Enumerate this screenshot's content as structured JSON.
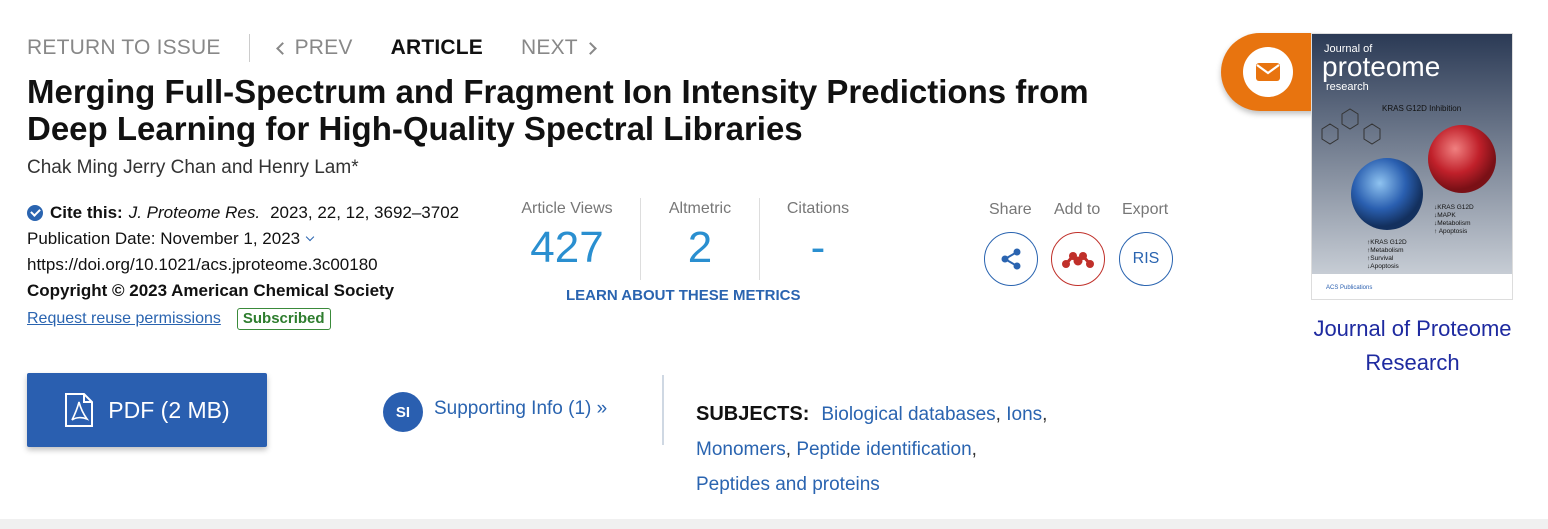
{
  "nav": {
    "return_label": "RETURN TO ISSUE",
    "prev_label": "PREV",
    "article_label": "ARTICLE",
    "next_label": "NEXT"
  },
  "article": {
    "title": "Merging Full-Spectrum and Fragment Ion Intensity Predictions from Deep Learning for High-Quality Spectral Libraries",
    "authors": "Chak Ming Jerry Chan and Henry Lam*",
    "cite_label": "Cite this:",
    "cite_journal": "J. Proteome Res.",
    "cite_ref": "2023, 22, 12, 3692–3702",
    "publication_date": "Publication Date: November 1, 2023",
    "doi": "https://doi.org/10.1021/acs.jproteome.3c00180",
    "copyright": "Copyright © 2023 American Chemical Society",
    "reuse_link": "Request reuse permissions",
    "access_badge": "Subscribed"
  },
  "metrics": {
    "views_label": "Article Views",
    "views_value": "427",
    "altmetric_label": "Altmetric",
    "altmetric_value": "2",
    "citations_label": "Citations",
    "citations_value": "-",
    "learn_link": "LEARN ABOUT THESE METRICS"
  },
  "actions": {
    "share_label": "Share",
    "add_label": "Add to",
    "export_label": "Export",
    "ris_label": "RIS"
  },
  "cover": {
    "journal_line1": "Journal of",
    "journal_line2": "proteome",
    "journal_line3": "research",
    "cover_heading": "KRAS G12D Inhibition",
    "right_list": [
      "↓KRAS G12D",
      "↓MAPK",
      "↓Metabolism",
      "↑ Apoptosis"
    ],
    "left_list": [
      "↑KRAS G12D",
      "↑Metabolism",
      "↑Survival",
      "↓Apoptosis"
    ],
    "publisher": "ACS Publications",
    "journal_link": "Journal of Proteome Research"
  },
  "pdf": {
    "label": "PDF (2 MB)"
  },
  "supporting": {
    "badge": "SI",
    "label": "Supporting Info (1) »"
  },
  "subjects": {
    "label": "SUBJECTS:",
    "items": [
      "Biological databases",
      "Ions",
      "Monomers",
      "Peptide identification",
      "Peptides and proteins"
    ]
  },
  "colors": {
    "accent_blue": "#2a64b0",
    "metric_blue": "#2a8fd0",
    "mail_orange": "#e8740f",
    "mendeley_red": "#c0302a",
    "subscribed_green": "#2e7d2e"
  }
}
